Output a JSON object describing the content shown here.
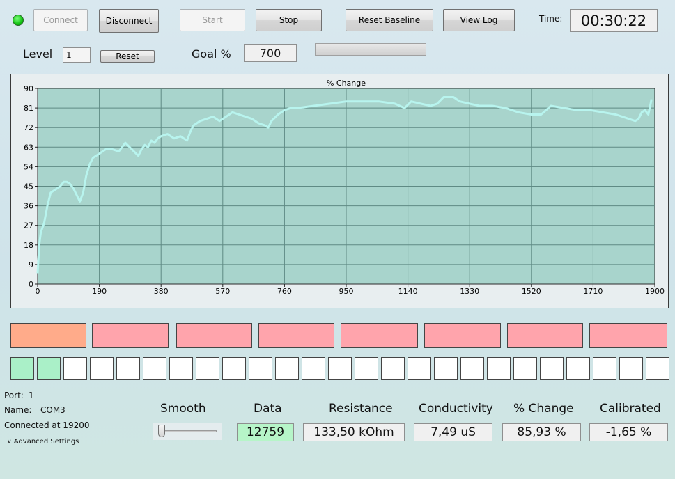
{
  "toolbar": {
    "connect_label": "Connect",
    "disconnect_label": "Disconnect",
    "start_label": "Start",
    "stop_label": "Stop",
    "reset_baseline_label": "Reset Baseline",
    "view_log_label": "View Log",
    "time_label": "Time:",
    "time_value": "00:30:22",
    "status_color": "#11c211"
  },
  "level": {
    "label": "Level",
    "value": "1",
    "reset_label": "Reset",
    "goal_label": "Goal %",
    "goal_value": "700",
    "progress_fraction": 0.0
  },
  "chart_data": {
    "type": "line",
    "title": "% Change",
    "xlim": [
      0,
      1900
    ],
    "ylim": [
      0,
      90
    ],
    "x_ticks": [
      0,
      190,
      380,
      570,
      760,
      950,
      1140,
      1330,
      1520,
      1710,
      1900
    ],
    "y_ticks": [
      0,
      9,
      18,
      27,
      36,
      45,
      54,
      63,
      72,
      81,
      90
    ],
    "grid": true,
    "line_color": "#b8f4ee",
    "plot_bg": "#a8d4cc",
    "series": [
      {
        "x": [
          0,
          5,
          10,
          20,
          30,
          40,
          50,
          60,
          70,
          80,
          90,
          100,
          110,
          120,
          130,
          140,
          150,
          160,
          170,
          180,
          190,
          210,
          230,
          250,
          270,
          290,
          310,
          320,
          330,
          340,
          350,
          360,
          370,
          380,
          400,
          420,
          440,
          460,
          470,
          480,
          500,
          520,
          540,
          560,
          580,
          600,
          620,
          640,
          660,
          680,
          700,
          710,
          720,
          740,
          760,
          780,
          800,
          850,
          900,
          950,
          1000,
          1050,
          1100,
          1130,
          1150,
          1180,
          1210,
          1230,
          1250,
          1280,
          1300,
          1330,
          1360,
          1400,
          1440,
          1480,
          1520,
          1550,
          1580,
          1620,
          1660,
          1700,
          1740,
          1780,
          1800,
          1820,
          1840,
          1850,
          1860,
          1870,
          1880,
          1890
        ],
        "values": [
          5,
          18,
          24,
          28,
          36,
          42,
          43,
          44,
          45,
          47,
          47,
          46,
          44,
          41,
          38,
          42,
          50,
          55,
          58,
          59,
          60,
          62,
          62,
          61,
          65,
          62,
          59,
          62,
          64,
          63,
          66,
          65,
          67,
          68,
          69,
          67,
          68,
          66,
          70,
          73,
          75,
          76,
          77,
          75,
          77,
          79,
          78,
          77,
          76,
          74,
          73,
          72,
          75,
          78,
          80,
          81,
          81,
          82,
          83,
          84,
          84,
          84,
          83,
          81,
          84,
          83,
          82,
          83,
          86,
          86,
          84,
          83,
          82,
          82,
          81,
          79,
          78,
          78,
          82,
          81,
          80,
          80,
          79,
          78,
          77,
          76,
          75,
          76,
          79,
          80,
          78,
          85
        ]
      }
    ]
  },
  "indicators": {
    "blocks": [
      {
        "color": "#ffab8a"
      },
      {
        "color": "#ffa4ac"
      },
      {
        "color": "#ffa4ac"
      },
      {
        "color": "#ffa4ac"
      },
      {
        "color": "#ffa4ac"
      },
      {
        "color": "#ffa4ac"
      },
      {
        "color": "#ffa4ac"
      },
      {
        "color": "#ffa4ac"
      }
    ],
    "cells_lit": 2,
    "cells_total": 25,
    "lit_color": "#aaf0c8",
    "off_color": "#ffffff"
  },
  "port": {
    "port_label": "Port:",
    "port_value": "1",
    "name_label": "Name:",
    "name_value": "COM3",
    "connected_text": "Connected at 19200",
    "advanced_label": "Advanced Settings"
  },
  "readouts": {
    "smooth_label": "Smooth",
    "smooth_value": 0.0,
    "data_label": "Data",
    "data_value": "12759",
    "resistance_label": "Resistance",
    "resistance_value": "133,50 kOhm",
    "conductivity_label": "Conductivity",
    "conductivity_value": "7,49 uS",
    "change_label": "% Change",
    "change_value": "85,93 %",
    "calibrated_label": "Calibrated",
    "calibrated_value": "-1,65 %"
  }
}
